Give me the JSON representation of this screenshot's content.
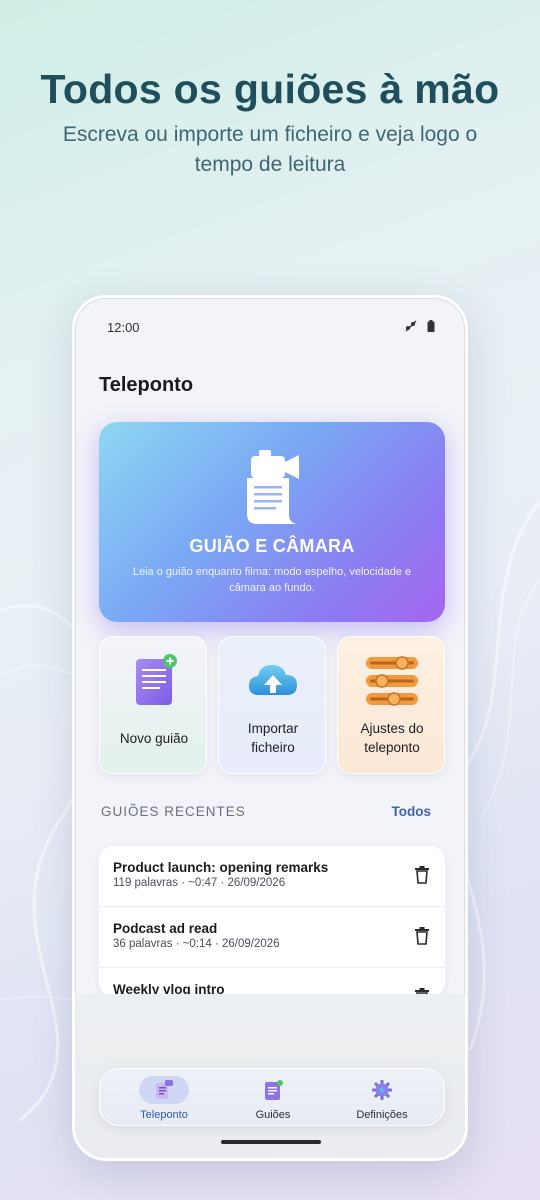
{
  "promo": {
    "headline": "Todos os guiões à mão",
    "subheadline": "Escreva ou importe um ficheiro e veja logo o tempo de leitura"
  },
  "status_bar": {
    "time": "12:00",
    "icons": [
      "signal-icon",
      "battery-icon"
    ]
  },
  "app": {
    "title": "Teleponto"
  },
  "hero": {
    "title": "GUIÃO E CÂMARA",
    "description": "Leia o guião enquanto filma: modo espelho, velocidade e câmara ao fundo.",
    "icon": "script-camera-icon"
  },
  "tiles": [
    {
      "label": "Novo guião",
      "icon": "new-script-icon"
    },
    {
      "label": "Importar ficheiro",
      "icon": "cloud-upload-icon"
    },
    {
      "label": "Ajustes do teleponto",
      "icon": "sliders-icon"
    }
  ],
  "recent": {
    "section_title": "GUIÕES RECENTES",
    "see_all": "Todos",
    "items": [
      {
        "title": "Product launch: opening remarks",
        "meta": "119 palavras · ~0:47 · 26/09/2026"
      },
      {
        "title": "Podcast ad read",
        "meta": "36 palavras · ~0:14 · 26/09/2026"
      },
      {
        "title": "Weekly vlog intro",
        "meta": ""
      }
    ]
  },
  "bottom_nav": [
    {
      "label": "Teleponto",
      "icon": "teleprompter-icon",
      "active": true
    },
    {
      "label": "Guiões",
      "icon": "scripts-icon",
      "active": false
    },
    {
      "label": "Definições",
      "icon": "gear-icon",
      "active": false
    }
  ],
  "colors": {
    "headline": "#1f4f5c",
    "accent": "#2f57b5",
    "hero_start": "#8ed7f3",
    "hero_end": "#a565ef"
  }
}
